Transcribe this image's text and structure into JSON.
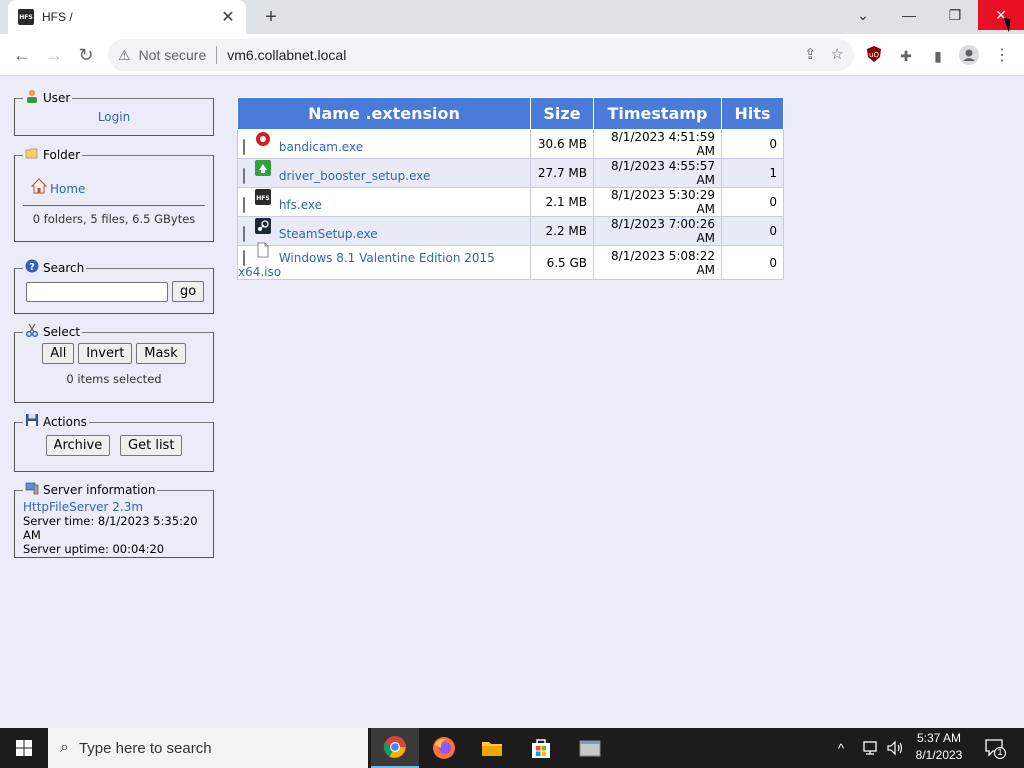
{
  "browser": {
    "tab_title": "HFS /",
    "tab_favicon_text": "HFS",
    "not_secure": "Not secure",
    "url": "vm6.collabnet.local"
  },
  "sidebar": {
    "user": {
      "legend": "User",
      "login": "Login"
    },
    "folder": {
      "legend": "Folder",
      "home": "Home",
      "summary": "0 folders, 5 files, 6.5 GBytes"
    },
    "search": {
      "legend": "Search",
      "go": "go",
      "value": ""
    },
    "select": {
      "legend": "Select",
      "all": "All",
      "invert": "Invert",
      "mask": "Mask",
      "status": "0 items selected"
    },
    "actions": {
      "legend": "Actions",
      "archive": "Archive",
      "getlist": "Get list"
    },
    "server": {
      "legend": "Server information",
      "software": "HttpFileServer 2.3m",
      "time": "Server time: 8/1/2023 5:35:20 AM",
      "uptime": "Server uptime: 00:04:20"
    }
  },
  "table": {
    "headers": {
      "name": "Name .extension",
      "size": "Size",
      "timestamp": "Timestamp",
      "hits": "Hits"
    },
    "rows": [
      {
        "name": "bandicam.exe",
        "size": "30.6 MB",
        "timestamp": "8/1/2023 4:51:59 AM",
        "hits": "0",
        "icon": "bandicam-icon"
      },
      {
        "name": "driver_booster_setup.exe",
        "size": "27.7 MB",
        "timestamp": "8/1/2023 4:55:57 AM",
        "hits": "1",
        "icon": "driver-booster-icon"
      },
      {
        "name": "hfs.exe",
        "size": "2.1 MB",
        "timestamp": "8/1/2023 5:30:29 AM",
        "hits": "0",
        "icon": "hfs-icon"
      },
      {
        "name": "SteamSetup.exe",
        "size": "2.2 MB",
        "timestamp": "8/1/2023 7:00:26 AM",
        "hits": "0",
        "icon": "steam-icon"
      },
      {
        "name": "Windows 8.1 Valentine Edition 2015 x64.iso",
        "size": "6.5 GB",
        "timestamp": "8/1/2023 5:08:22 AM",
        "hits": "0",
        "icon": "file-icon"
      }
    ]
  },
  "taskbar": {
    "search_placeholder": "Type here to search",
    "time": "5:37 AM",
    "date": "8/1/2023",
    "notification_count": "1"
  },
  "colors": {
    "header_blue": "#4a7bd8",
    "link_blue": "#3366aa",
    "page_bg": "#ececf8",
    "close_red": "#e81123"
  }
}
